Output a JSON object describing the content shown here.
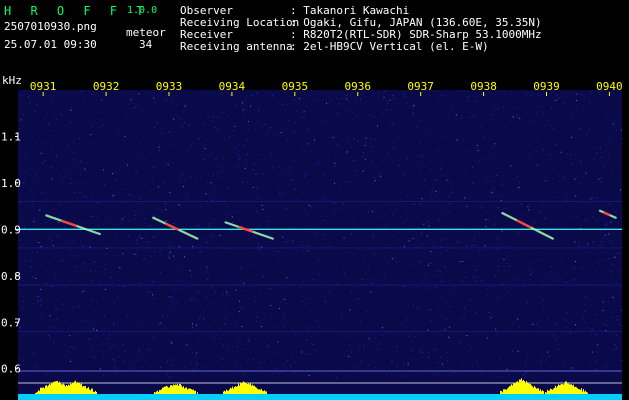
{
  "header": {
    "app_title": "H R O F F T",
    "app_version": "1.0.0",
    "filename": "2507010930.png",
    "datetime": "25.07.01 09:30",
    "count_label": "meteor",
    "count_value": "34",
    "info_keys": [
      "Observer",
      "Receiving Location",
      "Receiver",
      "Receiving antenna"
    ],
    "info_values": [
      ": Takanori Kawachi",
      ": Ogaki, Gifu, JAPAN (136.60E, 35.35N)",
      ": R820T2(RTL-SDR) SDR-Sharp 53.1000MHz",
      ": 2el-HB9CV Vertical (el. E-W)"
    ]
  },
  "colors": {
    "background": "#000000",
    "plot_background": "#0a0a4a",
    "text": "#ffffff",
    "title_green": "#00ff66",
    "tick_label": "#ffff00",
    "carrier_line": "#3fe0e0",
    "meteor_trace": "#ff4040",
    "bottom_activity": "#ffff00",
    "bottom_baseline": "#00d0ff"
  },
  "chart_data": {
    "type": "heatmap",
    "ylabel": "kHz",
    "x_tick_labels": [
      "0931",
      "0932",
      "0933",
      "0934",
      "0935",
      "0936",
      "0937",
      "0938",
      "0939",
      "0940"
    ],
    "x_range_minutes": [
      30.6,
      40.2
    ],
    "y_ticks": [
      1.1,
      1.0,
      0.9,
      0.8,
      0.7,
      0.6
    ],
    "y_tick_labels": [
      "1.1",
      "1.0",
      "0.9",
      "0.8",
      "0.7",
      "0.6"
    ],
    "y_range_khz": [
      0.58,
      1.2
    ],
    "carrier_khz": 0.9,
    "meteor_traces": [
      {
        "x_start": 31.05,
        "x_end": 31.9,
        "y_start": 0.93,
        "y_end": 0.89
      },
      {
        "x_start": 32.75,
        "x_end": 33.45,
        "y_start": 0.925,
        "y_end": 0.88
      },
      {
        "x_start": 33.9,
        "x_end": 34.65,
        "y_start": 0.915,
        "y_end": 0.88
      },
      {
        "x_start": 38.3,
        "x_end": 39.1,
        "y_start": 0.935,
        "y_end": 0.88
      },
      {
        "x_start": 39.85,
        "x_end": 40.1,
        "y_start": 0.94,
        "y_end": 0.925
      }
    ],
    "activity_peaks": [
      {
        "x": 31.2,
        "level": 0.6
      },
      {
        "x": 31.5,
        "level": 0.55
      },
      {
        "x": 33.1,
        "level": 0.45
      },
      {
        "x": 34.2,
        "level": 0.55
      },
      {
        "x": 38.6,
        "level": 0.65
      },
      {
        "x": 39.3,
        "level": 0.5
      }
    ],
    "grid": false
  }
}
